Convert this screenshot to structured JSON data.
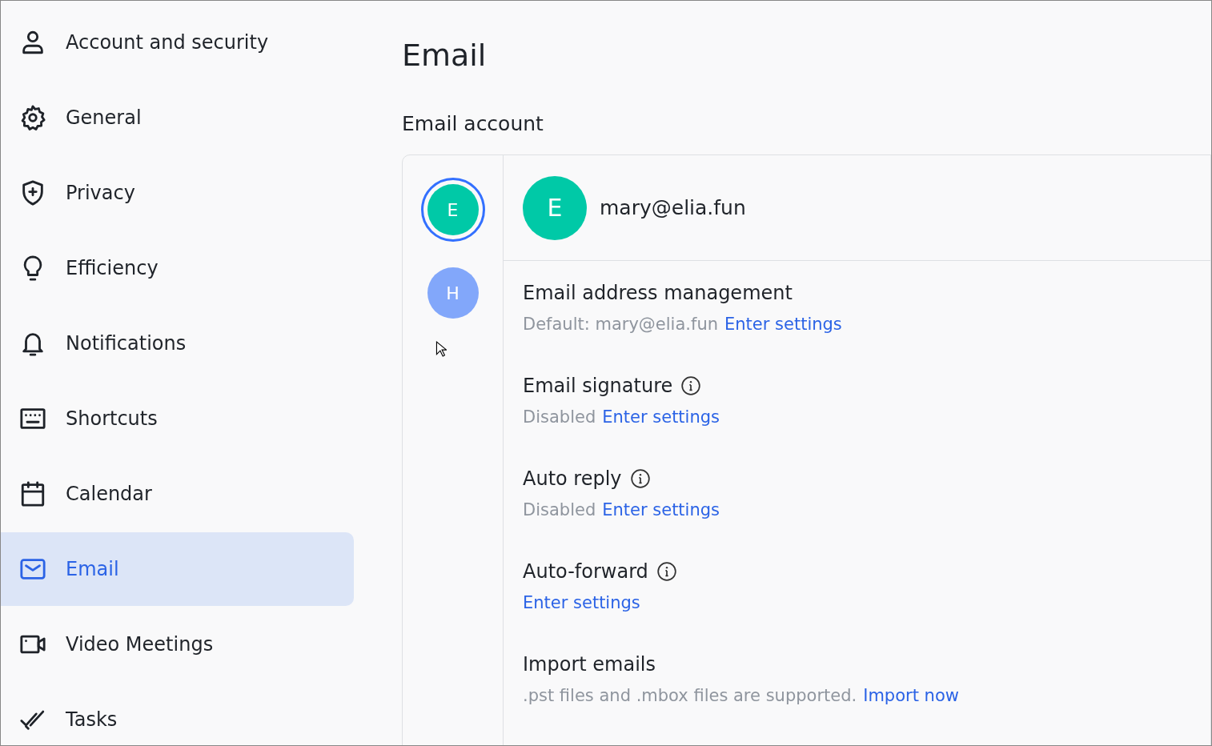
{
  "sidebar": {
    "items": [
      {
        "kind": "user",
        "label": "Account and security",
        "selected": false
      },
      {
        "kind": "gear",
        "label": "General",
        "selected": false
      },
      {
        "kind": "shield",
        "label": "Privacy",
        "selected": false
      },
      {
        "kind": "bulb",
        "label": "Efficiency",
        "selected": false
      },
      {
        "kind": "bell",
        "label": "Notifications",
        "selected": false
      },
      {
        "kind": "keyboard",
        "label": "Shortcuts",
        "selected": false
      },
      {
        "kind": "calendar",
        "label": "Calendar",
        "selected": false
      },
      {
        "kind": "mail",
        "label": "Email",
        "selected": true
      },
      {
        "kind": "video",
        "label": "Video Meetings",
        "selected": false
      },
      {
        "kind": "tasks",
        "label": "Tasks",
        "selected": false
      }
    ]
  },
  "page_title": "Email",
  "section_title": "Email account",
  "accounts": [
    {
      "initial": "E",
      "color": "#00c9a7",
      "selected": true
    },
    {
      "initial": "H",
      "color": "#82a7fa",
      "selected": false
    }
  ],
  "current_account": {
    "initial": "E",
    "color": "#00c9a7",
    "address": "mary@elia.fun"
  },
  "settings": [
    {
      "title": "Email address management",
      "info": false,
      "status": "Default: mary@elia.fun",
      "link": "Enter settings"
    },
    {
      "title": "Email signature",
      "info": true,
      "status": "Disabled",
      "link": "Enter settings"
    },
    {
      "title": "Auto reply",
      "info": true,
      "status": "Disabled",
      "link": "Enter settings"
    },
    {
      "title": "Auto-forward",
      "info": true,
      "link": "Enter settings"
    },
    {
      "title": "Import emails",
      "info": false,
      "status": ".pst files and .mbox files are supported.",
      "link": "Import now"
    }
  ]
}
